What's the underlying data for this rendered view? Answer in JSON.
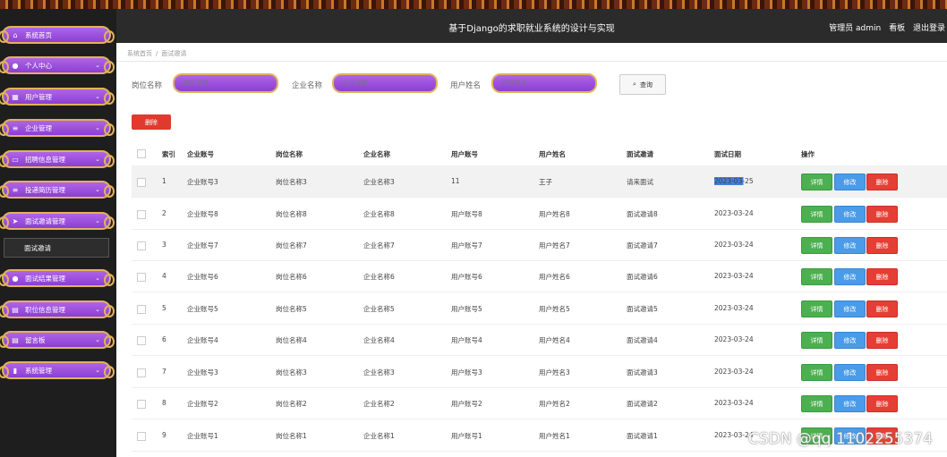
{
  "header": {
    "title": "基于Django的求职就业系统的设计与实现",
    "admin": "管理员 admin",
    "board": "看板",
    "logout": "退出登录"
  },
  "sidebar": {
    "items": [
      {
        "label": "系统首页",
        "icon": "home-icon",
        "chev": false
      },
      {
        "label": "个人中心",
        "icon": "user-icon",
        "chev": true
      },
      {
        "label": "用户管理",
        "icon": "grid-icon",
        "chev": true
      },
      {
        "label": "企业管理",
        "icon": "list-icon",
        "chev": true
      },
      {
        "label": "招聘信息管理",
        "icon": "monitor-icon",
        "chev": true
      },
      {
        "label": "投递简历管理",
        "icon": "list-icon",
        "chev": true
      },
      {
        "label": "面试邀请管理",
        "icon": "send-icon",
        "chev": true
      },
      {
        "label": "面试结果管理",
        "icon": "user-icon",
        "chev": true
      },
      {
        "label": "职位信息管理",
        "icon": "calendar-icon",
        "chev": true
      },
      {
        "label": "留言板",
        "icon": "calendar-icon",
        "chev": true
      },
      {
        "label": "系统管理",
        "icon": "bar-chart-icon",
        "chev": true
      }
    ],
    "sub_item": "面试邀请"
  },
  "breadcrumb": {
    "home": "系统首页",
    "current": "面试邀请"
  },
  "search": {
    "job_label": "岗位名称",
    "job_placeholder": "岗位名称",
    "company_label": "企业名称",
    "company_placeholder": "企业名称",
    "user_label": "用户姓名",
    "user_placeholder": "用户姓名",
    "button": "查询"
  },
  "delete_label": "删除",
  "table": {
    "headers": [
      "索引",
      "企业账号",
      "岗位名称",
      "企业名称",
      "用户账号",
      "用户姓名",
      "面试邀请",
      "面试日期",
      "操作"
    ],
    "rows": [
      [
        "1",
        "企业账号3",
        "岗位名称3",
        "企业名称3",
        "11",
        "王子",
        "请来面试",
        "2023-03-25"
      ],
      [
        "2",
        "企业账号8",
        "岗位名称8",
        "企业名称8",
        "用户账号8",
        "用户姓名8",
        "面试邀请8",
        "2023-03-24"
      ],
      [
        "3",
        "企业账号7",
        "岗位名称7",
        "企业名称7",
        "用户账号7",
        "用户姓名7",
        "面试邀请7",
        "2023-03-24"
      ],
      [
        "4",
        "企业账号6",
        "岗位名称6",
        "企业名称6",
        "用户账号6",
        "用户姓名6",
        "面试邀请6",
        "2023-03-24"
      ],
      [
        "5",
        "企业账号5",
        "岗位名称5",
        "企业名称5",
        "用户账号5",
        "用户姓名5",
        "面试邀请5",
        "2023-03-24"
      ],
      [
        "6",
        "企业账号4",
        "岗位名称4",
        "企业名称4",
        "用户账号4",
        "用户姓名4",
        "面试邀请4",
        "2023-03-24"
      ],
      [
        "7",
        "企业账号3",
        "岗位名称3",
        "企业名称3",
        "用户账号3",
        "用户姓名3",
        "面试邀请3",
        "2023-03-24"
      ],
      [
        "8",
        "企业账号2",
        "岗位名称2",
        "企业名称2",
        "用户账号2",
        "用户姓名2",
        "面试邀请2",
        "2023-03-24"
      ],
      [
        "9",
        "企业账号1",
        "岗位名称1",
        "企业名称1",
        "用户账号1",
        "用户姓名1",
        "面试邀请1",
        "2023-03-24"
      ]
    ],
    "actions": {
      "detail": "详情",
      "edit": "修改",
      "delete": "删除"
    }
  },
  "watermark": "CSDN @qq 1102255374",
  "colors": {
    "accent": "#9a4fe0",
    "detail": "#4caf50",
    "edit": "#4a9be8",
    "delete": "#e53e34",
    "sidebar": "#1e1e1e",
    "header": "#2b2b2b"
  }
}
